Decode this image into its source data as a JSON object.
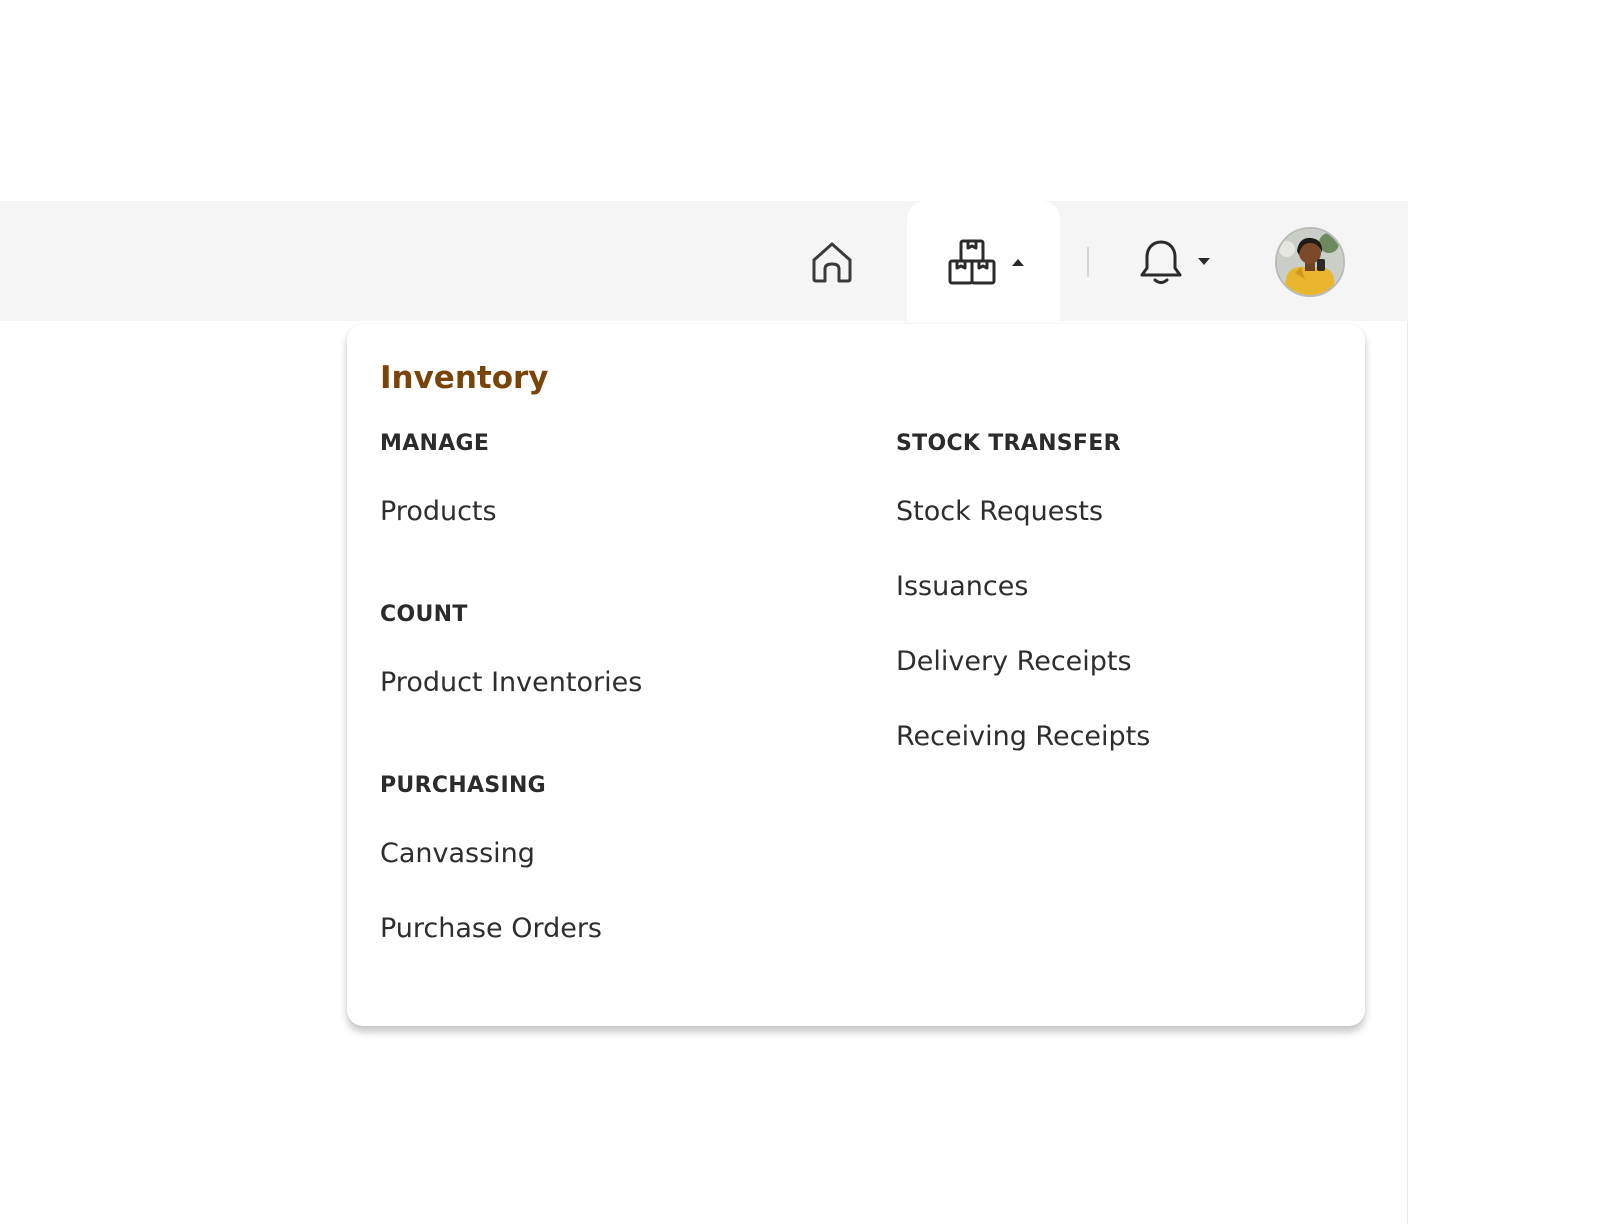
{
  "navbar": {
    "icons": {
      "home": "home-icon",
      "inventory": "boxes-icon",
      "inventory_caret": "caret-up-icon",
      "notifications": "bell-icon",
      "notifications_caret": "caret-down-icon",
      "avatar": "user-avatar"
    },
    "active_tab": "inventory"
  },
  "dropdown": {
    "title": "Inventory",
    "columns": [
      {
        "sections": [
          {
            "heading": "MANAGE",
            "items": [
              "Products"
            ]
          },
          {
            "heading": "COUNT",
            "items": [
              "Product Inventories"
            ]
          },
          {
            "heading": "PURCHASING",
            "items": [
              "Canvassing",
              "Purchase Orders"
            ]
          }
        ]
      },
      {
        "sections": [
          {
            "heading": "STOCK TRANSFER",
            "items": [
              "Stock Requests",
              "Issuances",
              "Delivery Receipts",
              "Receiving Receipts"
            ]
          }
        ]
      }
    ]
  },
  "colors": {
    "title_accent": "#7a4409",
    "topbar_bg": "#f5f5f5",
    "text": "#2b2b2b"
  }
}
